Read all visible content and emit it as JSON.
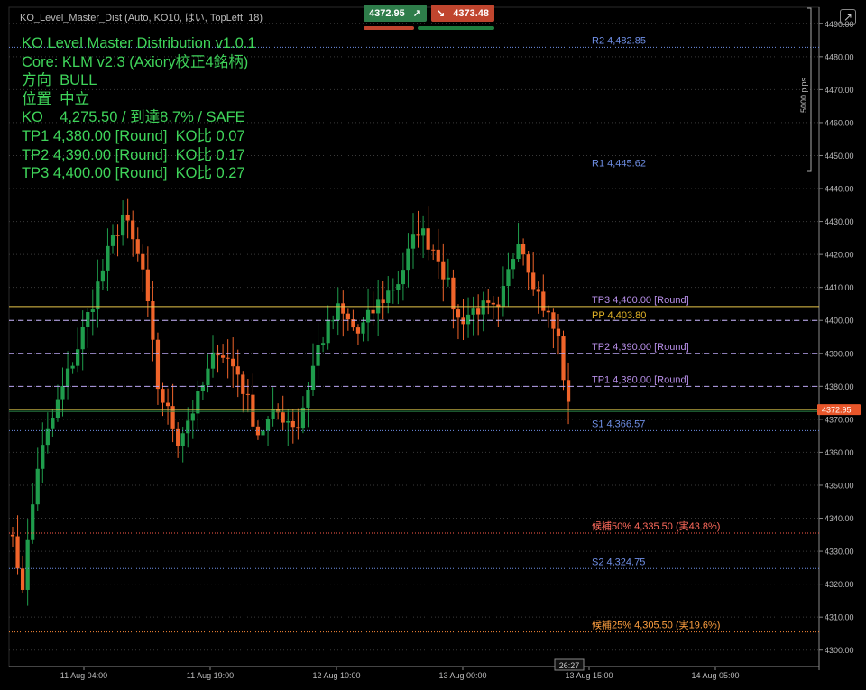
{
  "indicator": {
    "title": "KO_Level_Master_Dist (Auto, KO10, はい, TopLeft, 18)"
  },
  "hud": {
    "lines": [
      "KO Level Master Distribution v1.0.1",
      "Core: KLM v2.3 (Axiory校正4銘柄)",
      "方向  BULL",
      "位置  中立",
      "KO    4,275.50 / 到達8.7% / SAFE",
      "TP1 4,380.00 [Round]  KO比 0.07",
      "TP2 4,390.00 [Round]  KO比 0.17",
      "TP3 4,400.00 [Round]  KO比 0.27"
    ],
    "color": "#3fd45a"
  },
  "trade": {
    "sell_price": "4372.95",
    "buy_price": "4373.48",
    "sell_icon": "arrow-up-right-icon",
    "buy_icon": "arrow-down-right-icon"
  },
  "scale_label": "5000 pips",
  "crosshair_label": "26:27",
  "colors": {
    "bull": "#1f9d4c",
    "bear": "#f0642a",
    "grid": "#3a3a3a",
    "axis_text": "#bcbcbd",
    "current_price_bg": "#e8562a"
  },
  "chart_data": {
    "type": "candlestick",
    "ylim": [
      4295,
      4495
    ],
    "yticks": [
      4300,
      4310,
      4320,
      4330,
      4340,
      4350,
      4360,
      4370,
      4380,
      4390,
      4400,
      4410,
      4420,
      4430,
      4440,
      4450,
      4460,
      4470,
      4480,
      4490
    ],
    "xtick_labels": [
      "11 Aug 04:00",
      "11 Aug 19:00",
      "12 Aug 10:00",
      "13 Aug 00:00",
      "13 Aug 15:00",
      "14 Aug 05:00"
    ],
    "current_price": 4372.95,
    "current_price_label": "4372.95",
    "levels": [
      {
        "label": "R2 4,482.85",
        "value": 4482.85,
        "color": "#6f8fe6",
        "style": "dotted"
      },
      {
        "label": "R1 4,445.62",
        "value": 4445.62,
        "color": "#6f8fe6",
        "style": "dotted"
      },
      {
        "label": "TP3 4,400.00 [Round]",
        "value": 4404.2,
        "color": "#b78ee8",
        "style": "solid-yellow"
      },
      {
        "label": "PP 4,403.80",
        "value": 4400.0,
        "color": "#e5b628",
        "style": "dashed"
      },
      {
        "label": "TP2 4,390.00 [Round]",
        "value": 4390.0,
        "color": "#b78ee8",
        "style": "dashed"
      },
      {
        "label": "TP1 4,380.00 [Round]",
        "value": 4380.0,
        "color": "#b78ee8",
        "style": "dashed"
      },
      {
        "label": "S1 4,366.57",
        "value": 4366.57,
        "color": "#6f8fe6",
        "style": "dotted"
      },
      {
        "label": "候補50% 4,335.50 (実43.8%)",
        "value": 4335.5,
        "color": "#ff6a5c",
        "style": "dotted-red"
      },
      {
        "label": "S2 4,324.75",
        "value": 4324.75,
        "color": "#6f8fe6",
        "style": "dotted"
      },
      {
        "label": "候補25% 4,305.50 (実19.6%)",
        "value": 4305.5,
        "color": "#ffa040",
        "style": "dotted-orange"
      }
    ]
  }
}
